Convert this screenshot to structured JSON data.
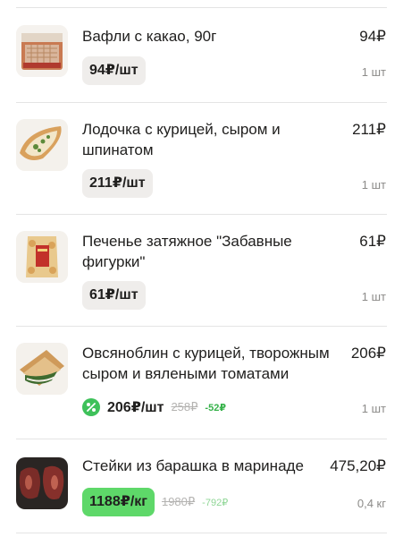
{
  "items": [
    {
      "name": "Вафли с какао, 90г",
      "price": "94₽",
      "unit_price": "94₽/шт",
      "qty": "1 шт",
      "thumb_icon": "waffle-pack-icon"
    },
    {
      "name": "Лодочка с курицей, сыром и шпинатом",
      "price": "211₽",
      "unit_price": "211₽/шт",
      "qty": "1 шт",
      "thumb_icon": "boat-pastry-icon"
    },
    {
      "name": "Печенье затяжное \"Забавные фигурки\"",
      "price": "61₽",
      "unit_price": "61₽/шт",
      "qty": "1 шт",
      "thumb_icon": "cookie-bag-icon"
    },
    {
      "name": "Овсяноблин с курицей, творожным сыром и вялеными томатами",
      "price": "206₽",
      "unit_price": "206₽/шт",
      "old_price": "258₽",
      "discount": "-52₽",
      "qty": "1 шт",
      "thumb_icon": "oat-pancake-icon"
    },
    {
      "name": "Стейки из барашка в маринаде",
      "price": "475,20₽",
      "unit_price": "1188₽/кг",
      "old_price": "1980₽",
      "discount": "-792₽",
      "qty": "0,4 кг",
      "thumb_icon": "lamb-steak-icon"
    }
  ],
  "colors": {
    "accent_green": "#5ed869",
    "discount_text": "#36b24a",
    "chip_bg": "#efedeb"
  }
}
